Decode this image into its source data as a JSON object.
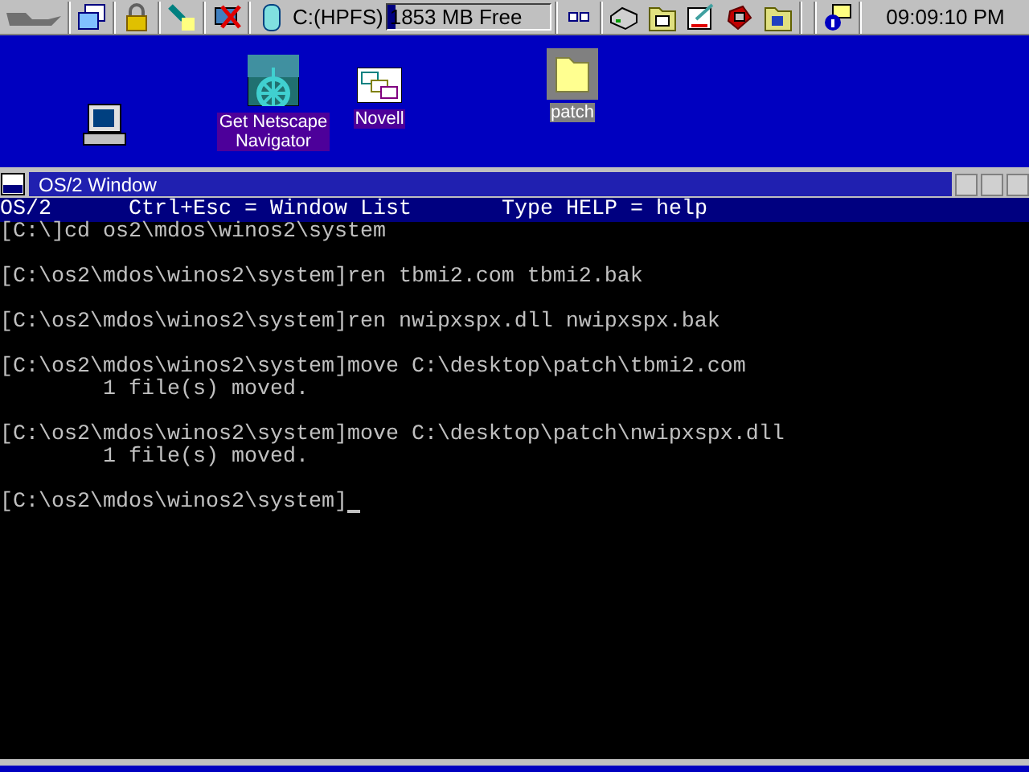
{
  "launchpad": {
    "drive": {
      "name": "C:(HPFS)",
      "free": "1853 MB Free",
      "level": 0.05
    },
    "clock": "09:09:10 PM"
  },
  "desktop_icons": [
    {
      "kind": "computer",
      "selected": false
    },
    {
      "kind": "netscape",
      "label": "Get Netscape Navigator",
      "selected": false
    },
    {
      "kind": "novell",
      "label": "Novell",
      "selected": false
    },
    {
      "kind": "folder",
      "label": "patch",
      "selected": true
    }
  ],
  "window": {
    "title": "OS/2 Window",
    "status": [
      "OS/2",
      "Ctrl+Esc = Window List",
      "Type HELP = help"
    ],
    "blocks": [
      [
        "[C:\\]cd os2\\mdos\\winos2\\system"
      ],
      [
        "[C:\\os2\\mdos\\winos2\\system]ren tbmi2.com tbmi2.bak"
      ],
      [
        "[C:\\os2\\mdos\\winos2\\system]ren nwipxspx.dll nwipxspx.bak"
      ],
      [
        "[C:\\os2\\mdos\\winos2\\system]move C:\\desktop\\patch\\tbmi2.com",
        "        1 file(s) moved."
      ],
      [
        "[C:\\os2\\mdos\\winos2\\system]move C:\\desktop\\patch\\nwipxspx.dll",
        "        1 file(s) moved."
      ]
    ],
    "prompt": "[C:\\os2\\mdos\\winos2\\system]"
  }
}
